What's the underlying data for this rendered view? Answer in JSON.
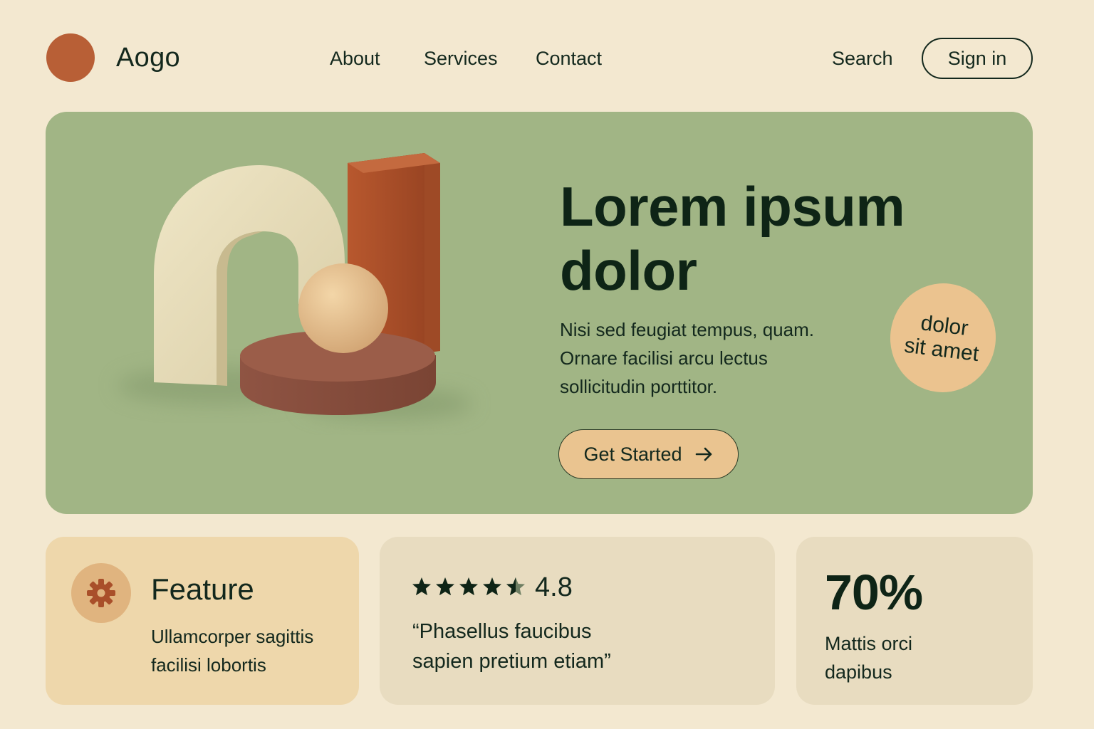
{
  "brand": {
    "name": "Aogo",
    "logo_color": "#b85f36"
  },
  "nav": {
    "links": [
      "About",
      "Services",
      "Contact"
    ],
    "search_label": "Search",
    "signin_label": "Sign in"
  },
  "hero": {
    "title_lines": [
      "Lorem ipsum",
      "dolor"
    ],
    "body_lines": [
      "Nisi sed feugiat tempus, quam.",
      "Ornare facilisi arcu lectus",
      "sollicitudin porttitor."
    ],
    "cta_label": "Get Started",
    "cta_icon": "arrow-right-icon",
    "badge_lines": [
      "dolor",
      "sit amet"
    ],
    "background": "#a1b585"
  },
  "cards": {
    "feature": {
      "icon": "gear-icon",
      "title": "Feature",
      "text_lines": [
        "Ullamcorper sagittis",
        "facilisi lobortis"
      ]
    },
    "rating": {
      "stars": 4.5,
      "value": "4.8",
      "quote_lines": [
        "“Phasellus faucibus",
        "sapien pretium etiam”"
      ]
    },
    "stat": {
      "value": "70%",
      "label_lines": [
        "Mattis orci",
        "dapibus"
      ]
    }
  },
  "colors": {
    "page_bg": "#f3e8d0",
    "ink": "#13281d",
    "accent": "#eac490",
    "terracotta": "#b85f36"
  }
}
